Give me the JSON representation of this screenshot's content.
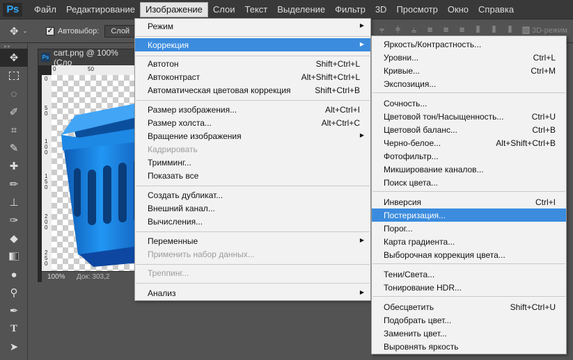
{
  "app": {
    "logo": "Ps"
  },
  "menubar": [
    "Файл",
    "Редактирование",
    "Изображение",
    "Слои",
    "Текст",
    "Выделение",
    "Фильтр",
    "3D",
    "Просмотр",
    "Окно",
    "Справка"
  ],
  "options": {
    "move_icon": "move-icon",
    "auto_select_label": "Автовыбор:",
    "auto_select_value": "Слой",
    "mode_3d": "3D-режим"
  },
  "document": {
    "tab_title": "cart.png @ 100% (Сло",
    "zoom": "100%",
    "size": "Док: 303,2",
    "ruler_top": [
      "0",
      "50"
    ],
    "ruler_left": [
      "0",
      "5 0",
      "1 0 0",
      "1 5 0",
      "2 0 0",
      "2 5 0"
    ]
  },
  "image_menu": {
    "mode": "Режим",
    "adjustments": "Коррекция",
    "auto_tone": "Автотон",
    "auto_tone_sc": "Shift+Ctrl+L",
    "auto_contrast": "Автоконтраст",
    "auto_contrast_sc": "Alt+Shift+Ctrl+L",
    "auto_color": "Автоматическая цветовая коррекция",
    "auto_color_sc": "Shift+Ctrl+B",
    "image_size": "Размер изображения...",
    "image_size_sc": "Alt+Ctrl+I",
    "canvas_size": "Размер холста...",
    "canvas_size_sc": "Alt+Ctrl+C",
    "rotation": "Вращение изображения",
    "crop": "Кадрировать",
    "trim": "Тримминг...",
    "reveal_all": "Показать все",
    "duplicate": "Создать дубликат...",
    "apply_image": "Внешний канал...",
    "calculations": "Вычисления...",
    "variables": "Переменные",
    "apply_dataset": "Применить набор данных...",
    "trap": "Треппинг...",
    "analysis": "Анализ"
  },
  "adjust_menu": {
    "brightness": "Яркость/Контрастность...",
    "levels": "Уровни...",
    "levels_sc": "Ctrl+L",
    "curves": "Кривые...",
    "curves_sc": "Ctrl+M",
    "exposure": "Экспозиция...",
    "vibrance": "Сочность...",
    "hue": "Цветовой тон/Насыщенность...",
    "hue_sc": "Ctrl+U",
    "color_balance": "Цветовой баланс...",
    "color_balance_sc": "Ctrl+B",
    "bw": "Черно-белое...",
    "bw_sc": "Alt+Shift+Ctrl+B",
    "photo_filter": "Фотофильтр...",
    "channel_mixer": "Микширование каналов...",
    "color_lookup": "Поиск цвета...",
    "invert": "Инверсия",
    "invert_sc": "Ctrl+I",
    "posterize": "Постеризация...",
    "threshold": "Порог...",
    "gradient_map": "Карта градиента...",
    "selective_color": "Выборочная коррекция цвета...",
    "shadows": "Тени/Света...",
    "hdr": "Тонирование HDR...",
    "desaturate": "Обесцветить",
    "desaturate_sc": "Shift+Ctrl+U",
    "match_color": "Подобрать цвет...",
    "replace_color": "Заменить цвет...",
    "equalize": "Выровнять яркость"
  },
  "colors": {
    "highlight": "#3b8cde",
    "ps_blue": "#31a8ff",
    "basket": "#1e88e5"
  }
}
